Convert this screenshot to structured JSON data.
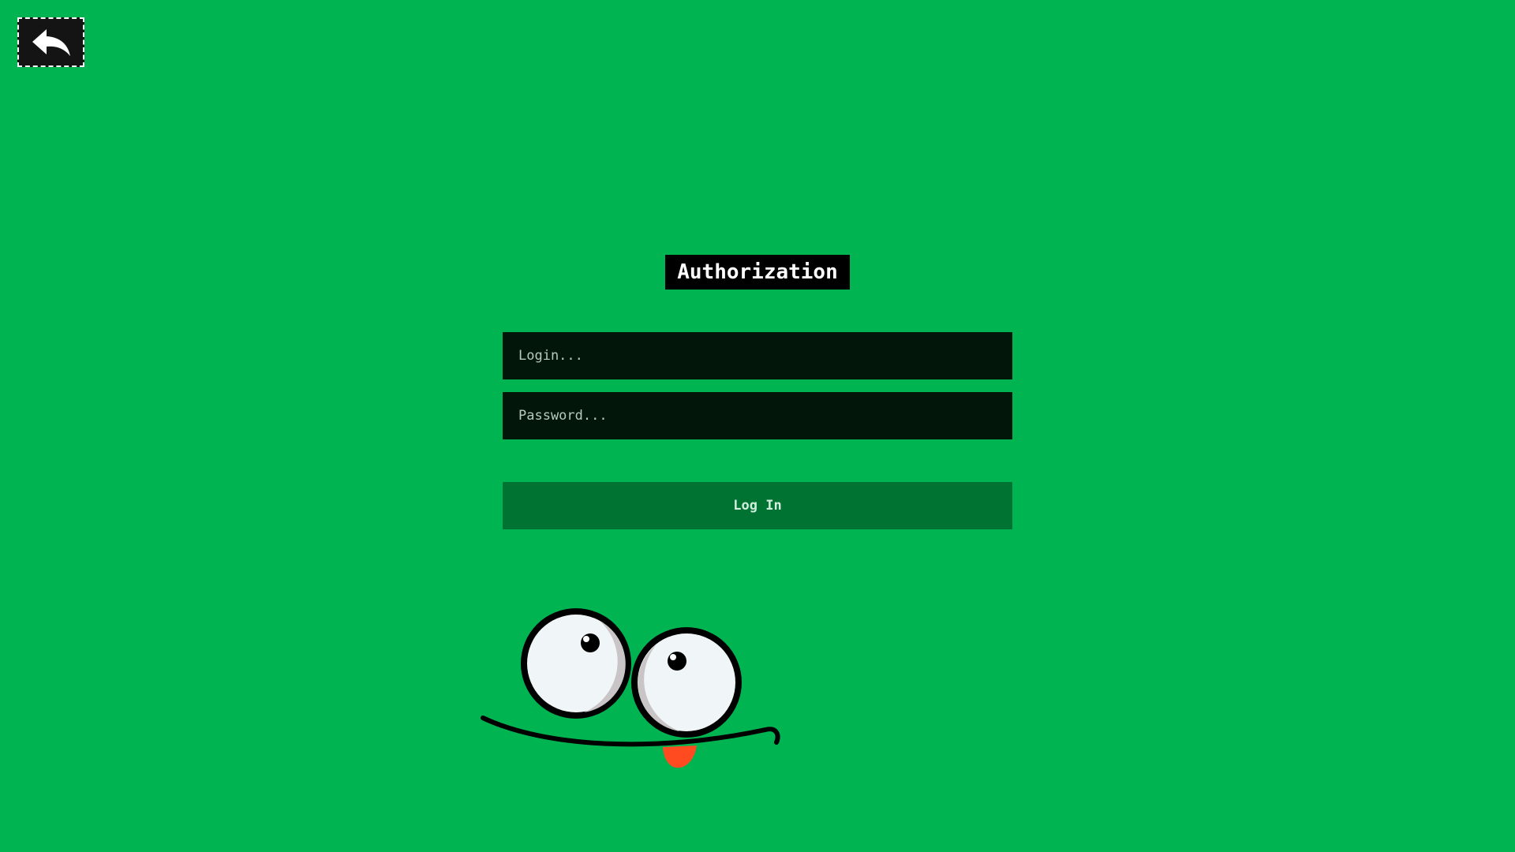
{
  "nav": {
    "back_icon": "back-arrow-icon"
  },
  "auth": {
    "title": "Authorization",
    "login_placeholder": "Login...",
    "login_value": "",
    "password_placeholder": "Password...",
    "password_value": "",
    "submit_label": "Log In"
  },
  "mascot": {
    "icon": "cartoon-face-icon"
  },
  "colors": {
    "background": "#00b551",
    "title_bg": "#000000",
    "field_bg": "#02170a",
    "button_bg": "#007232",
    "tongue": "#ff4b1f"
  }
}
